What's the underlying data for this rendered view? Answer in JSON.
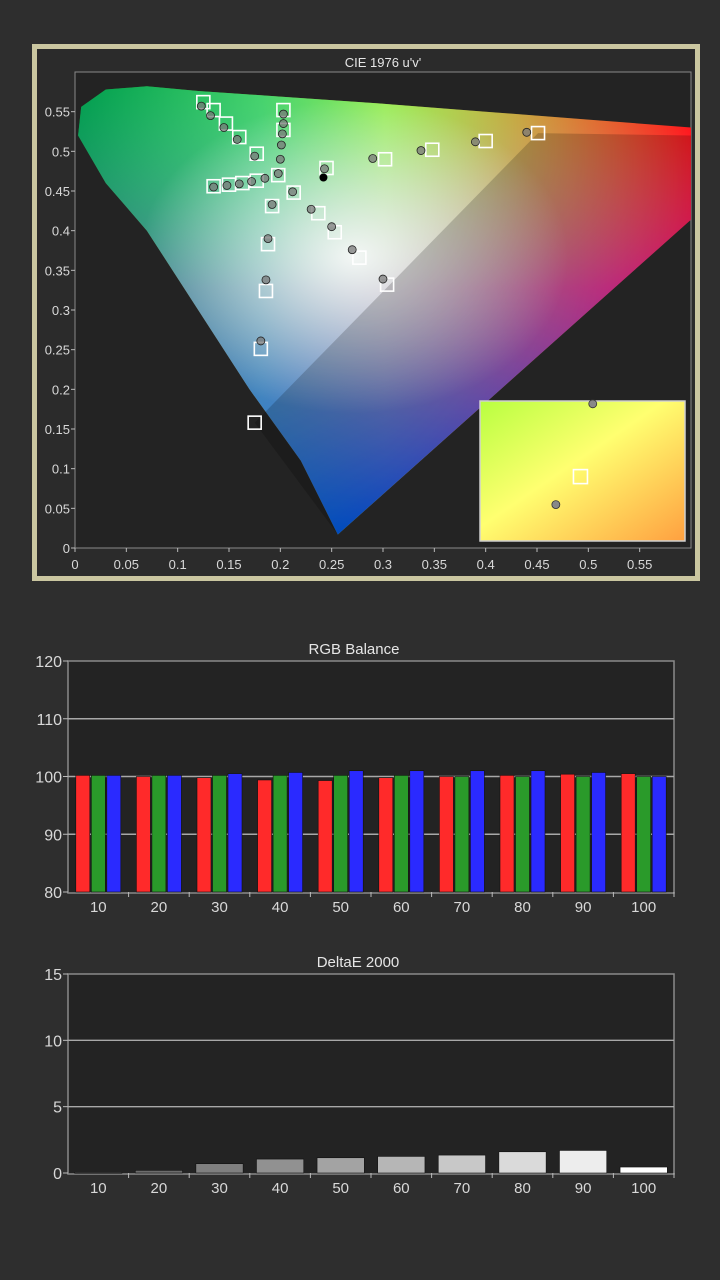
{
  "chart_data": [
    {
      "type": "scatter",
      "title": "CIE 1976 u'v'",
      "xlim": [
        0,
        0.6
      ],
      "ylim": [
        0,
        0.6
      ],
      "xticks": [
        0,
        0.05,
        0.1,
        0.15,
        0.2,
        0.25,
        0.3,
        0.35,
        0.4,
        0.45,
        0.5,
        0.55
      ],
      "yticks": [
        0,
        0.05,
        0.1,
        0.15,
        0.2,
        0.25,
        0.3,
        0.35,
        0.4,
        0.45,
        0.5,
        0.55
      ],
      "gamut_triangle": [
        [
          0.451,
          0.523
        ],
        [
          0.125,
          0.562
        ],
        [
          0.175,
          0.158
        ]
      ],
      "targets": [
        [
          0.125,
          0.562
        ],
        [
          0.135,
          0.552
        ],
        [
          0.147,
          0.535
        ],
        [
          0.16,
          0.518
        ],
        [
          0.177,
          0.497
        ],
        [
          0.203,
          0.552
        ],
        [
          0.203,
          0.527
        ],
        [
          0.135,
          0.456
        ],
        [
          0.15,
          0.458
        ],
        [
          0.163,
          0.46
        ],
        [
          0.177,
          0.463
        ],
        [
          0.198,
          0.47
        ],
        [
          0.451,
          0.523
        ],
        [
          0.4,
          0.513
        ],
        [
          0.348,
          0.502
        ],
        [
          0.302,
          0.49
        ],
        [
          0.245,
          0.479
        ],
        [
          0.213,
          0.448
        ],
        [
          0.192,
          0.431
        ],
        [
          0.237,
          0.422
        ],
        [
          0.253,
          0.398
        ],
        [
          0.277,
          0.366
        ],
        [
          0.304,
          0.332
        ],
        [
          0.188,
          0.383
        ],
        [
          0.186,
          0.324
        ],
        [
          0.181,
          0.251
        ],
        [
          0.175,
          0.158
        ]
      ],
      "measured": [
        [
          0.123,
          0.557
        ],
        [
          0.132,
          0.545
        ],
        [
          0.145,
          0.53
        ],
        [
          0.158,
          0.515
        ],
        [
          0.175,
          0.494
        ],
        [
          0.203,
          0.547
        ],
        [
          0.203,
          0.535
        ],
        [
          0.202,
          0.522
        ],
        [
          0.201,
          0.508
        ],
        [
          0.2,
          0.49
        ],
        [
          0.135,
          0.455
        ],
        [
          0.148,
          0.457
        ],
        [
          0.16,
          0.459
        ],
        [
          0.172,
          0.462
        ],
        [
          0.185,
          0.466
        ],
        [
          0.198,
          0.472
        ],
        [
          0.44,
          0.524
        ],
        [
          0.39,
          0.512
        ],
        [
          0.337,
          0.501
        ],
        [
          0.29,
          0.491
        ],
        [
          0.243,
          0.478
        ],
        [
          0.212,
          0.449
        ],
        [
          0.192,
          0.433
        ],
        [
          0.23,
          0.427
        ],
        [
          0.25,
          0.405
        ],
        [
          0.27,
          0.376
        ],
        [
          0.3,
          0.339
        ],
        [
          0.188,
          0.39
        ],
        [
          0.186,
          0.338
        ],
        [
          0.181,
          0.261
        ]
      ],
      "white_point": [
        0.242,
        0.467
      ],
      "inset": {
        "measured": [
          [
            0.55,
            0.98
          ],
          [
            0.37,
            0.26
          ]
        ],
        "target": [
          0.49,
          0.46
        ]
      }
    },
    {
      "type": "bar",
      "title": "RGB Balance",
      "categories": [
        "10",
        "20",
        "30",
        "40",
        "50",
        "60",
        "70",
        "80",
        "90",
        "100"
      ],
      "ylim": [
        80,
        120
      ],
      "yticks": [
        80,
        90,
        100,
        110,
        120
      ],
      "series": [
        {
          "color": "#ff2a2a",
          "values": [
            100.2,
            100.0,
            99.8,
            99.4,
            99.3,
            99.8,
            100.0,
            100.2,
            100.4,
            100.5
          ]
        },
        {
          "color": "#2a9a2a",
          "values": [
            100.2,
            100.2,
            100.2,
            100.2,
            100.2,
            100.2,
            100.0,
            100.0,
            100.0,
            100.0
          ]
        },
        {
          "color": "#2a2aff",
          "values": [
            100.2,
            100.2,
            100.5,
            100.7,
            101.0,
            101.0,
            101.0,
            101.0,
            100.7,
            100.0
          ]
        }
      ]
    },
    {
      "type": "bar",
      "title": "DeltaE 2000",
      "categories": [
        "10",
        "20",
        "30",
        "40",
        "50",
        "60",
        "70",
        "80",
        "90",
        "100"
      ],
      "ylim": [
        0,
        15
      ],
      "yticks": [
        0,
        5,
        10,
        15
      ],
      "values": [
        0.05,
        0.2,
        0.7,
        1.05,
        1.15,
        1.25,
        1.35,
        1.6,
        1.7,
        0.45
      ]
    }
  ]
}
